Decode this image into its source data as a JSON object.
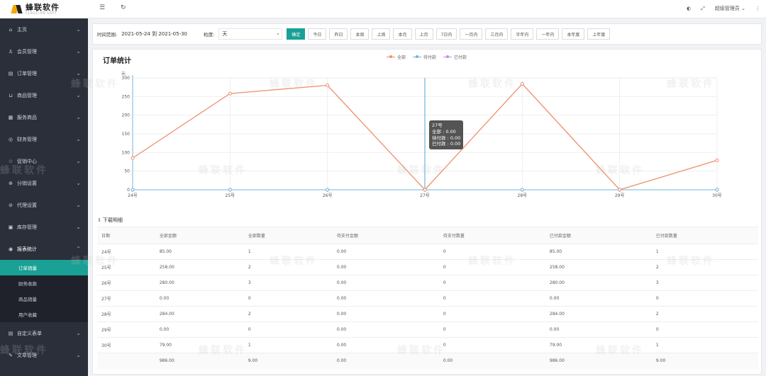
{
  "logo": {
    "cn": "蜂联软件",
    "en": "FENGLIAN SOFT"
  },
  "sidebar": {
    "items": [
      {
        "label": "主页",
        "icon": "home-icon",
        "glyph": "⌂"
      },
      {
        "label": "会员管理",
        "icon": "user-icon",
        "glyph": "♙"
      },
      {
        "label": "订单管理",
        "icon": "order-icon",
        "glyph": "▤"
      },
      {
        "label": "商品管理",
        "icon": "cart-icon",
        "glyph": "⊔"
      },
      {
        "label": "服务商品",
        "icon": "service-icon",
        "glyph": "▦"
      },
      {
        "label": "财务管理",
        "icon": "finance-icon",
        "glyph": "◎"
      },
      {
        "label": "促销中心",
        "icon": "promo-icon",
        "glyph": "☆"
      },
      {
        "label": "分销设置",
        "icon": "distribution-icon",
        "glyph": "⊕"
      },
      {
        "label": "代理设置",
        "icon": "agent-icon",
        "glyph": "⊘"
      },
      {
        "label": "库存管理",
        "icon": "stock-icon",
        "glyph": "▣"
      },
      {
        "label": "报表统计",
        "icon": "report-icon",
        "glyph": "◉"
      }
    ],
    "report_sub": [
      {
        "label": "订单销量"
      },
      {
        "label": "财务收款"
      },
      {
        "label": "商品销量"
      },
      {
        "label": "用户收藏"
      }
    ],
    "bottom_items": [
      {
        "label": "自定义表单",
        "icon": "form-icon",
        "glyph": "▤"
      },
      {
        "label": "文章管理",
        "icon": "article-icon",
        "glyph": "✎"
      }
    ]
  },
  "topbar": {
    "user": "超级管理员"
  },
  "filter": {
    "range_label": "时间范围:",
    "range_value": "2021-05-24 到 2021-05-30",
    "unit_label": "粒度:",
    "unit_value": "天",
    "confirm": "确定",
    "quick": [
      "今日",
      "昨日",
      "本周",
      "上周",
      "本月",
      "上月",
      "7日内",
      "一月内",
      "三月内",
      "半年内",
      "一年内",
      "本年度",
      "上年度"
    ]
  },
  "card": {
    "title": "订单统计",
    "download": "下载明细"
  },
  "tooltip": {
    "title": "27号",
    "lines": [
      "全部 : 0.00",
      "待付款 : 0.00",
      "已付款 : 0.00"
    ]
  },
  "chart_data": {
    "type": "line",
    "categories": [
      "24号",
      "25号",
      "26号",
      "27号",
      "28号",
      "29号",
      "30号"
    ],
    "series": [
      {
        "name": "全部",
        "values": [
          85,
          258,
          280,
          0,
          284,
          0,
          79
        ],
        "color": "#f08e6b"
      },
      {
        "name": "待付款",
        "values": [
          0,
          0,
          0,
          0,
          0,
          0,
          0
        ],
        "color": "#6fb4dc"
      },
      {
        "name": "已付款",
        "values": [
          0,
          0,
          0,
          0,
          0,
          0,
          0
        ],
        "color": "#c48fd8"
      }
    ],
    "ylabel": "元",
    "ylim": [
      0,
      300
    ],
    "yticks": [
      0,
      50,
      100,
      150,
      200,
      250,
      300
    ],
    "grid": true,
    "legend": "top-center"
  },
  "table": {
    "headers": [
      "日期",
      "全部金额",
      "全部数量",
      "待支付金额",
      "待支付数量",
      "已付款金额",
      "已付款数量"
    ],
    "rows": [
      [
        "24号",
        "85.00",
        "1",
        "0.00",
        "0",
        "85.00",
        "1"
      ],
      [
        "25号",
        "258.00",
        "2",
        "0.00",
        "0",
        "258.00",
        "2"
      ],
      [
        "26号",
        "280.00",
        "3",
        "0.00",
        "0",
        "280.00",
        "3"
      ],
      [
        "27号",
        "0.00",
        "0",
        "0.00",
        "0",
        "0.00",
        "0"
      ],
      [
        "28号",
        "284.00",
        "2",
        "0.00",
        "0",
        "284.00",
        "2"
      ],
      [
        "29号",
        "0.00",
        "0",
        "0.00",
        "0",
        "0.00",
        "0"
      ],
      [
        "30号",
        "79.00",
        "1",
        "0.00",
        "0",
        "79.00",
        "1"
      ],
      [
        "",
        "986.00",
        "9.00",
        "0.00",
        "0.00",
        "986.00",
        "9.00"
      ]
    ]
  }
}
